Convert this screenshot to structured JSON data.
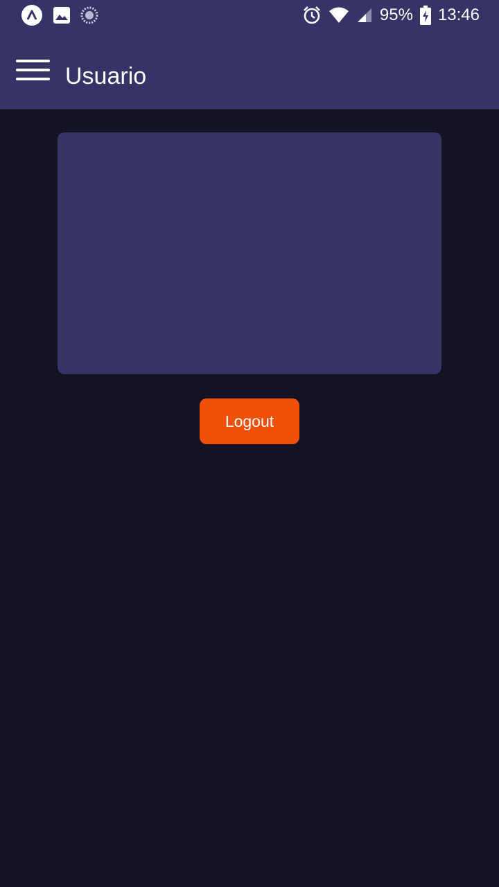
{
  "status_bar": {
    "left_icons": [
      "expo-icon",
      "image-icon",
      "loading-icon"
    ],
    "right_icons": [
      "alarm-icon",
      "wifi-icon",
      "signal-icon",
      "battery-charging-icon"
    ],
    "battery": "95%",
    "time": "13:46"
  },
  "app_bar": {
    "menu_icon": "hamburger-menu-icon",
    "title": "Usuario"
  },
  "main": {
    "logout_label": "Logout"
  },
  "colors": {
    "header_bg": "#363466",
    "page_bg": "#141324",
    "card_bg": "#363466",
    "button_bg": "#f05008",
    "text": "#ffffff"
  }
}
